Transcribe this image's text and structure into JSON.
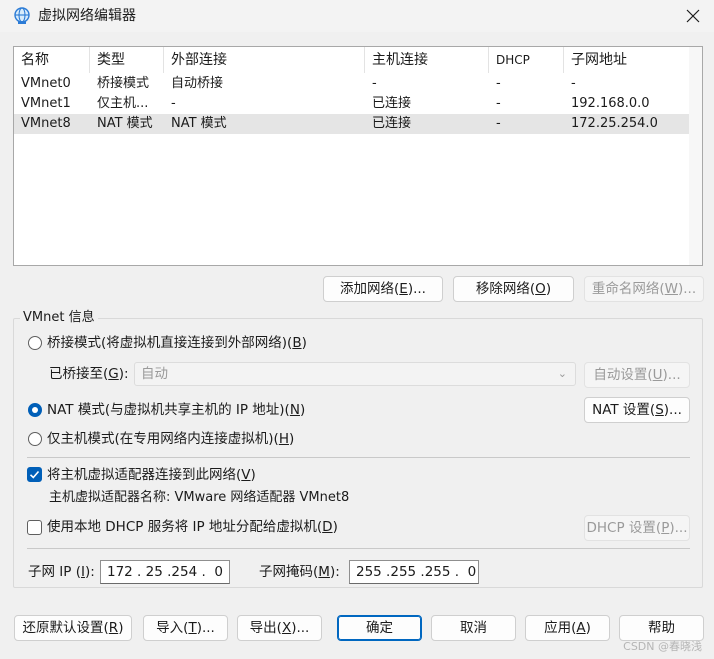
{
  "window": {
    "title": "虚拟网络编辑器"
  },
  "table": {
    "headers": [
      "名称",
      "类型",
      "外部连接",
      "主机连接",
      "DHCP",
      "子网地址"
    ],
    "rows": [
      [
        "VMnet0",
        "桥接模式",
        "自动桥接",
        "-",
        "-",
        "-"
      ],
      [
        "VMnet1",
        "仅主机...",
        "-",
        "已连接",
        "-",
        "192.168.0.0"
      ],
      [
        "VMnet8",
        "NAT 模式",
        "NAT 模式",
        "已连接",
        "-",
        "172.25.254.0"
      ]
    ],
    "selected_row": 2
  },
  "list_buttons": {
    "add": {
      "label": "添加网络(",
      "key": "E",
      "suffix": ")..."
    },
    "remove": {
      "label": "移除网络(",
      "key": "O",
      "suffix": ")"
    },
    "rename": {
      "label": "重命名网络(",
      "key": "W",
      "suffix": ")..."
    }
  },
  "vmnet_info": {
    "group_label": "VMnet 信息",
    "bridged": {
      "label": "桥接模式(将虚拟机直接连接到外部网络)(",
      "key": "B",
      "suffix": ")"
    },
    "bridged_to": {
      "label": "已桥接至(",
      "key": "G",
      "suffix": "):",
      "value": "自动"
    },
    "auto_settings": {
      "label": "自动设置(",
      "key": "U",
      "suffix": ")..."
    },
    "nat": {
      "label": "NAT 模式(与虚拟机共享主机的 IP 地址)(",
      "key": "N",
      "suffix": ")"
    },
    "nat_settings": {
      "label": "NAT 设置(",
      "key": "S",
      "suffix": ")..."
    },
    "host_only": {
      "label": "仅主机模式(在专用网络内连接虚拟机)(",
      "key": "H",
      "suffix": ")"
    },
    "connect_adapter": {
      "label": "将主机虚拟适配器连接到此网络(",
      "key": "V",
      "suffix": ")",
      "checked": true
    },
    "adapter_name": "主机虚拟适配器名称: VMware 网络适配器 VMnet8",
    "use_dhcp": {
      "label": "使用本地 DHCP 服务将 IP 地址分配给虚拟机(",
      "key": "D",
      "suffix": ")",
      "checked": false
    },
    "dhcp_settings": {
      "label": "DHCP 设置(",
      "key": "P",
      "suffix": ")..."
    },
    "subnet_ip": {
      "label": "子网 IP (",
      "key": "I",
      "suffix": "):",
      "value": "172 . 25 .254 .  0"
    },
    "subnet_mask": {
      "label": "子网掩码(",
      "key": "M",
      "suffix": "):",
      "value": "255 .255 .255 .  0"
    },
    "selected_mode": "nat"
  },
  "footer": {
    "restore": {
      "label": "还原默认设置(",
      "key": "R",
      "suffix": ")"
    },
    "import": {
      "label": "导入(",
      "key": "T",
      "suffix": ")..."
    },
    "export": {
      "label": "导出(",
      "key": "X",
      "suffix": ")..."
    },
    "ok": {
      "label": "确定"
    },
    "cancel": {
      "label": "取消"
    },
    "apply": {
      "label": "应用(",
      "key": "A",
      "suffix": ")"
    },
    "help": {
      "label": "帮助"
    }
  },
  "watermark": "CSDN @春晓浅",
  "colors": {
    "accent": "#005fb8",
    "selected_row": "#e5e5e5"
  }
}
